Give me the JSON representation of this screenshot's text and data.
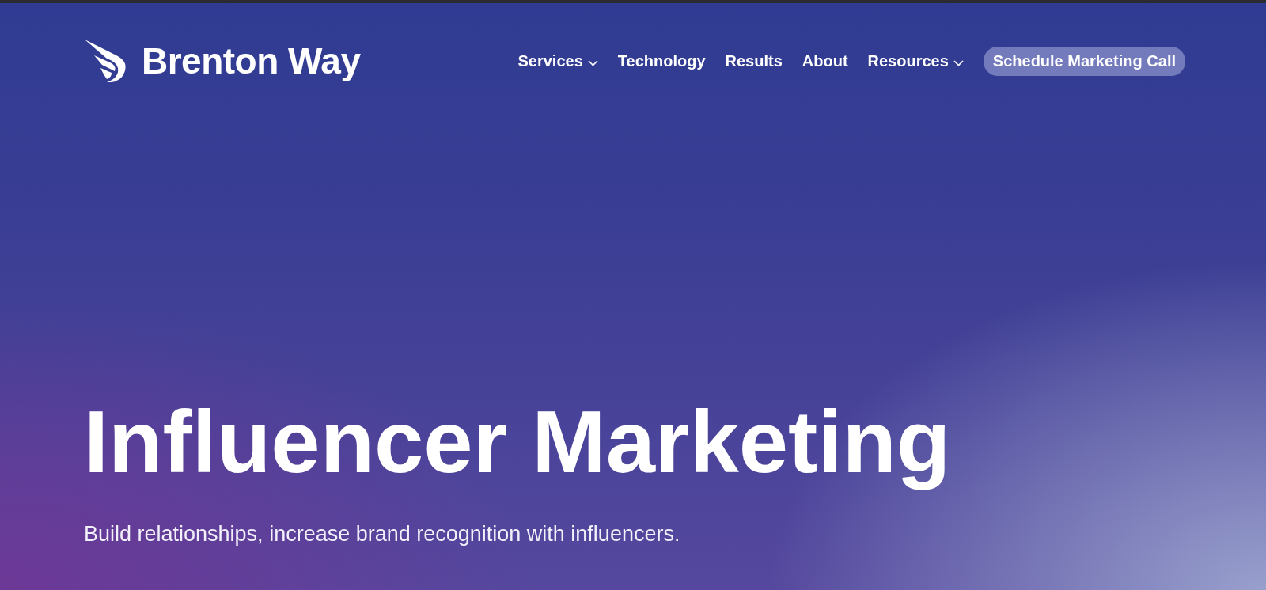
{
  "logo": {
    "text": "Brenton Way"
  },
  "nav": [
    {
      "label": "Services",
      "has_dropdown": true
    },
    {
      "label": "Technology",
      "has_dropdown": false
    },
    {
      "label": "Results",
      "has_dropdown": false
    },
    {
      "label": "About",
      "has_dropdown": false
    },
    {
      "label": "Resources",
      "has_dropdown": true
    }
  ],
  "cta": {
    "label": "Schedule Marketing Call"
  },
  "hero": {
    "title": "Influencer Marketing",
    "subtitle": "Build relationships, increase brand recognition with influencers."
  }
}
